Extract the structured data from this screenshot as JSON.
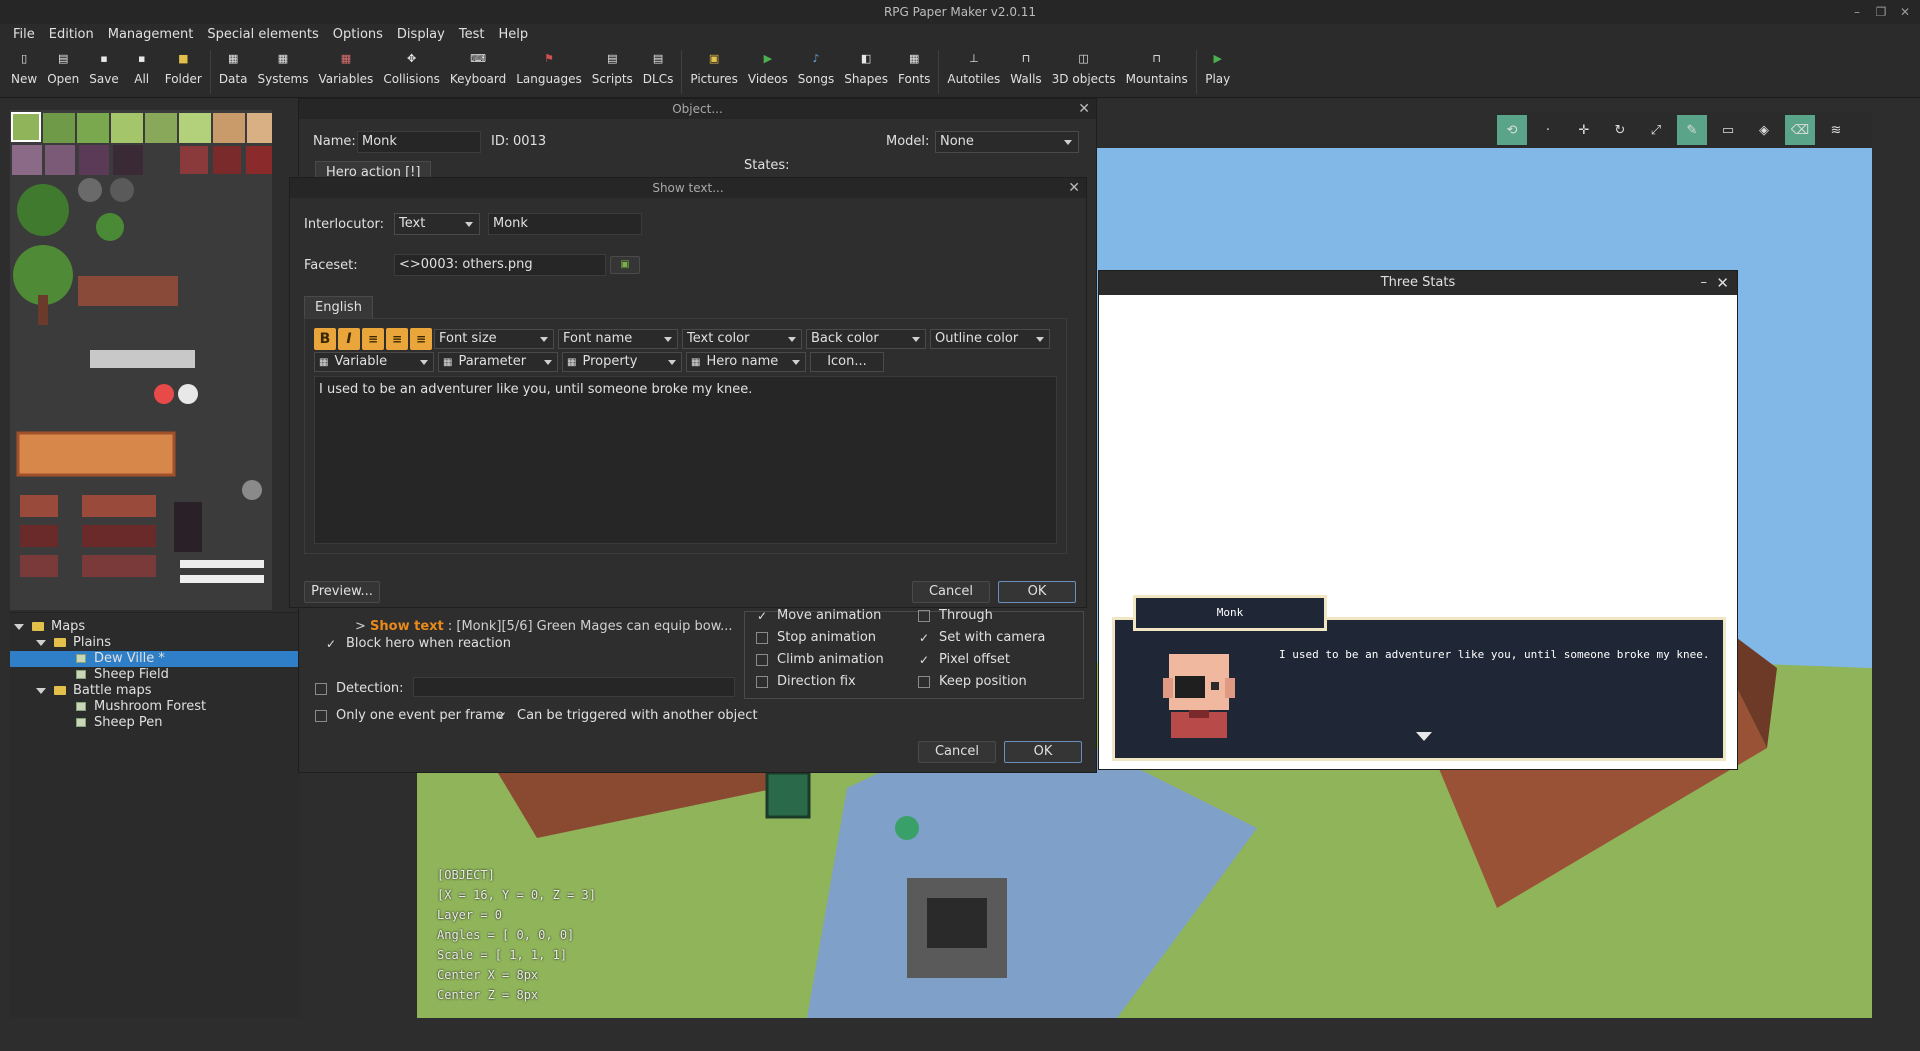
{
  "window": {
    "title": "RPG Paper Maker v2.0.11"
  },
  "menu": [
    "File",
    "Edition",
    "Management",
    "Special elements",
    "Options",
    "Display",
    "Test",
    "Help"
  ],
  "toolbar": {
    "new": "New",
    "open": "Open",
    "save": "Save",
    "all": "All",
    "folder": "Folder",
    "data": "Data",
    "systems": "Systems",
    "variables": "Variables",
    "collisions": "Collisions",
    "keyboard": "Keyboard",
    "languages": "Languages",
    "scripts": "Scripts",
    "dlcs": "DLCs",
    "pictures": "Pictures",
    "videos": "Videos",
    "songs": "Songs",
    "shapes": "Shapes",
    "fonts": "Fonts",
    "autotiles": "Autotiles",
    "walls": "Walls",
    "objects3d": "3D objects",
    "mountains": "Mountains",
    "play": "Play"
  },
  "tree": {
    "maps": "Maps",
    "plains": "Plains",
    "dew_ville": "Dew Ville *",
    "sheep_field": "Sheep Field",
    "battle_maps": "Battle maps",
    "mushroom_forest": "Mushroom Forest",
    "sheep_pen": "Sheep Pen"
  },
  "object_dialog": {
    "title": "Object...",
    "name_label": "Name:",
    "name_value": "Monk",
    "id_label": "ID:",
    "id_value": "0013",
    "model_label": "Model:",
    "model_value": "None",
    "states_label": "States:",
    "hero_action_tab": "Hero action [!]",
    "command_line_prefix": "> ",
    "command_show_text": "Show text",
    "command_rest": " : [Monk][5/6] Green Mages can equip bow...",
    "block_hero": "Block hero when reaction",
    "detection": "Detection:",
    "one_event": "Only one event per frame",
    "triggered": "Can be triggered with another object",
    "move_animation": "Move animation",
    "stop_animation": "Stop animation",
    "climb_animation": "Climb animation",
    "direction_fix": "Direction fix",
    "through": "Through",
    "set_with_camera": "Set with camera",
    "pixel_offset": "Pixel offset",
    "keep_position": "Keep position",
    "cancel": "Cancel",
    "ok": "OK"
  },
  "show_text_dialog": {
    "title": "Show text...",
    "interlocutor_label": "Interlocutor:",
    "interlocutor_type": "Text",
    "interlocutor_value": "Monk",
    "faceset_label": "Faceset:",
    "faceset_value": "<>0003: others.png",
    "tab_english": "English",
    "bold": "B",
    "italic": "I",
    "font_size": "Font size",
    "font_name": "Font name",
    "text_color": "Text color",
    "back_color": "Back color",
    "outline_color": "Outline color",
    "variable": "Variable",
    "parameter": "Parameter",
    "property": "Property",
    "hero_name": "Hero name",
    "icon": "Icon...",
    "text": "I used to be an adventurer like you, until someone broke my knee.",
    "preview": "Preview...",
    "cancel": "Cancel",
    "ok": "OK"
  },
  "preview_window": {
    "title": "Three Stats",
    "speaker": "Monk",
    "message": "I used to be an adventurer like you, until someone broke my knee."
  },
  "debug": [
    "[OBJECT]",
    "[X = 16, Y = 0, Z = 3]",
    "Layer = 0",
    "Angles = [ 0, 0, 0]",
    "Scale = [ 1, 1, 1]",
    "Center X = 8px",
    "Center Z = 8px"
  ],
  "colors": {
    "accent": "#2e7fc7",
    "format_button": "#eaa63a",
    "map_sky": "#82b8e7",
    "grass": "#8fb45a"
  }
}
